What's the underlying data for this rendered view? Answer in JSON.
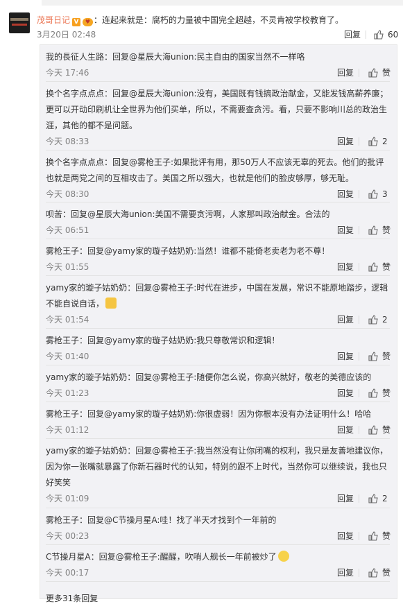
{
  "main": {
    "username": "茂哥日记",
    "separator": "：",
    "text": "连起来就是：腐朽的力量被中国完全超越，不灵肯被学校教育了。",
    "time": "3月20日 02:48",
    "reply_label": "回复",
    "likes": "60"
  },
  "replies": [
    {
      "text": "我的長征人生路：回复@星辰大海union:民主自由的国家当然不一样咯",
      "time": "今天 17:46",
      "reply_label": "回复",
      "likes": "赞"
    },
    {
      "text": "换个名字点点点：回复@星辰大海union:没有，美国既有钱搞政治献金，又能发钱高薪养廉；更可以开动印刷机让全世界为他们买单，所以，不需要查贪污。看，只要不影响川总的政治生涯，其他的都不是问题。",
      "time": "今天 08:33",
      "reply_label": "回复",
      "likes": "2"
    },
    {
      "text": "换个名字点点点：回复@雾枪王子:如果批评有用，那50万人不应该无辜的死去。他们的批评也就是两党之间的互相攻击了。美国之所以强大，也就是他们的脸皮够厚，够无耻。",
      "time": "今天 08:30",
      "reply_label": "回复",
      "likes": "3"
    },
    {
      "text": "呗苦：回复@星辰大海union:美国不需要贪污啊，人家那叫政治献金。合法的",
      "time": "今天 06:51",
      "reply_label": "回复",
      "likes": "赞"
    },
    {
      "text": "雾枪王子：回复@yamy家的璇子姑奶奶:当然！谁都不能倚老卖老为老不尊！",
      "time": "今天 01:55",
      "reply_label": "回复",
      "likes": "赞"
    },
    {
      "text": "yamy家的璇子姑奶奶：回复@雾枪王子:时代在进步，中国在发展，常识不能原地踏步，逻辑不能自说自话，",
      "time": "今天 01:54",
      "reply_label": "回复",
      "likes": "2"
    },
    {
      "text": "雾枪王子：回复@yamy家的璇子姑奶奶:我只尊敬常识和逻辑！",
      "time": "今天 01:40",
      "reply_label": "回复",
      "likes": "赞"
    },
    {
      "text": "yamy家的璇子姑奶奶：回复@雾枪王子:随便你怎么说，你高兴就好，敬老的美德应该的",
      "time": "今天 01:23",
      "reply_label": "回复",
      "likes": "赞"
    },
    {
      "text": "雾枪王子：回复@yamy家的璇子姑奶奶:你很虚弱！因为你根本没有办法证明什么！哈哈",
      "time": "今天 01:12",
      "reply_label": "回复",
      "likes": "赞"
    },
    {
      "text": "yamy家的璇子姑奶奶：回复@雾枪王子:我当然没有让你闭嘴的权利，我只是友善地建议你，因为你一张嘴就暴露了你新石器时代的认知，特别的跟不上时代，当然你可以继续说，我也只好笑笑",
      "time": "今天 01:09",
      "reply_label": "回复",
      "likes": "2"
    },
    {
      "text": "雾枪王子：回复@C节操月星A:哇！找了半天才找到个一年前的",
      "time": "今天 00:23",
      "reply_label": "回复",
      "likes": "赞"
    },
    {
      "text": "C节操月星A：回复@雾枪王子:醒醒，吹哨人舰长一年前被炒了",
      "time": "今天 00:17",
      "reply_label": "回复",
      "likes": "赞"
    }
  ],
  "more_label": "更多31条回复",
  "colors": {
    "username": "#eb7350",
    "meta": "#808080",
    "reply_bg": "#f2f2f5"
  }
}
